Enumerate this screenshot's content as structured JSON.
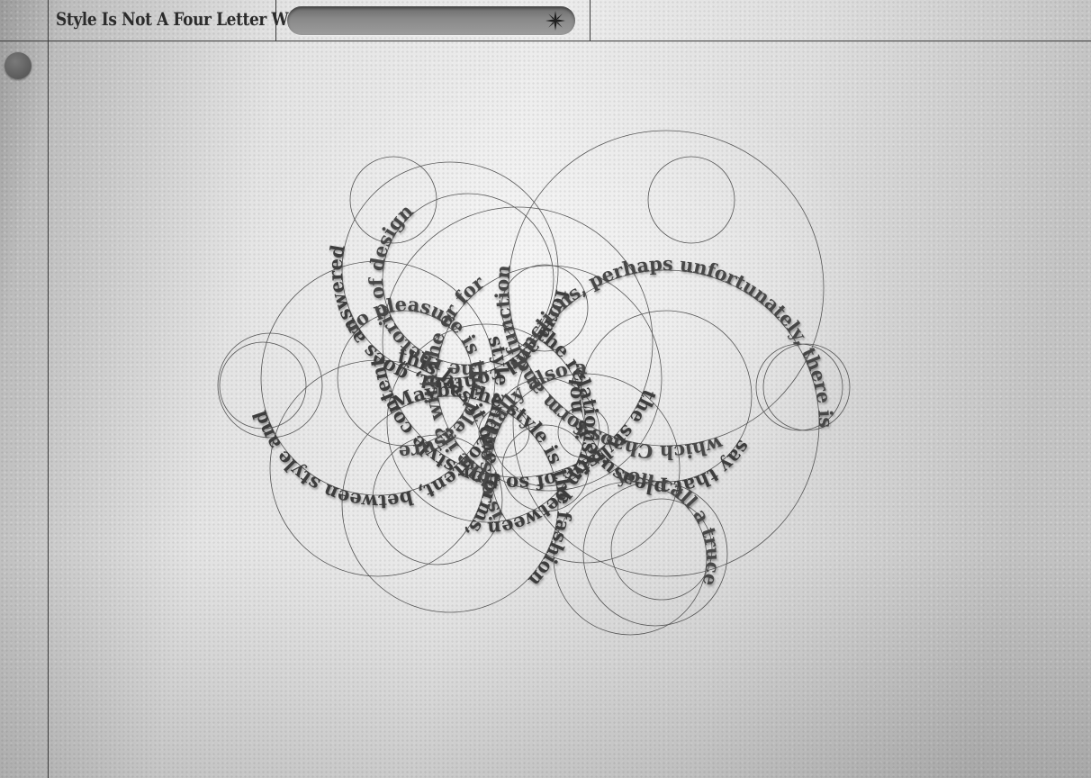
{
  "header": {
    "site_title": "Style Is Not A Four Letter Word",
    "search": {
      "value": "",
      "placeholder": ""
    },
    "search_icon": "eight-point-star-icon"
  },
  "sidebar": {
    "menu_button_icon": "dot-icon"
  },
  "artwork": {
    "rings": [
      {
        "text": "form and content, goes answered"
      },
      {
        "text": "which Chaos form and function"
      },
      {
        "text": "style and content, between style and"
      },
      {
        "text": "functions, perhaps unfortunately, there is"
      },
      {
        "text": "the stylistic of so tiny style content"
      },
      {
        "text": "so pleasure is the pleasure"
      },
      {
        "text": "say that pleasure is not,"
      },
      {
        "text": "like it? with the or for"
      },
      {
        "text": "the relationship between"
      },
      {
        "text": "the rhetoric of design"
      },
      {
        "text": "Maybe the style is the fashion"
      },
      {
        "text": "you call a truce"
      },
      {
        "text": "this has it one forms,"
      },
      {
        "text": "is essentially also a"
      }
    ]
  },
  "colors": {
    "ink": "#3d3d3d",
    "rule_lines": "#3a3a3a",
    "search_pill": "#8a8a8a",
    "dot_button": "#666666"
  }
}
